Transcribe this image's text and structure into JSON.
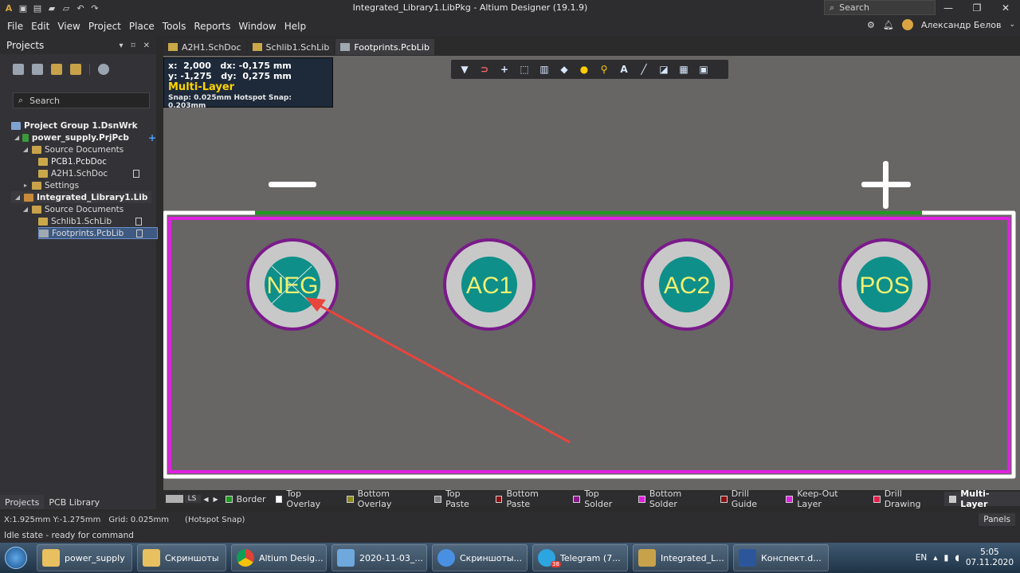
{
  "window": {
    "title": "Integrated_Library1.LibPkg - Altium Designer (19.1.9)",
    "search_placeholder": "Search",
    "controls": [
      "—",
      "❐",
      "✕"
    ]
  },
  "menu": [
    "File",
    "Edit",
    "View",
    "Project",
    "Place",
    "Tools",
    "Reports",
    "Window",
    "Help"
  ],
  "user": {
    "name": "Александр Белов"
  },
  "projects_panel": {
    "title": "Projects",
    "search_placeholder": "Search",
    "tree": [
      {
        "label": "Project Group 1.DsnWrk",
        "bold": true,
        "indent": 0
      },
      {
        "label": "power_supply.PrjPcb",
        "bold": true,
        "indent": 1
      },
      {
        "label": "Source Documents",
        "bold": false,
        "indent": 2
      },
      {
        "label": "PCB1.PcbDoc",
        "bold": false,
        "indent": 3
      },
      {
        "label": "A2H1.SchDoc",
        "bold": false,
        "indent": 3
      },
      {
        "label": "Settings",
        "bold": false,
        "indent": 2
      },
      {
        "label": "Integrated_Library1.Lib",
        "bold": true,
        "indent": 1
      },
      {
        "label": "Source Documents",
        "bold": false,
        "indent": 2
      },
      {
        "label": "Schlib1.SchLib",
        "bold": false,
        "indent": 3
      },
      {
        "label": "Footprints.PcbLib",
        "bold": false,
        "indent": 3
      }
    ],
    "tabs": [
      "Projects",
      "PCB Library"
    ]
  },
  "doc_tabs": [
    "A2H1.SchDoc",
    "Schlib1.SchLib",
    "Footprints.PcbLib"
  ],
  "hud": {
    "line1": "x:  2,000   dx: -0,175 mm",
    "line2": "y: -1,275   dy:  0,275 mm",
    "layer": "Multi-Layer",
    "snap": "Snap: 0.025mm Hotspot Snap: 0.203mm"
  },
  "canvas": {
    "minus_sign": "−",
    "plus_sign": "+",
    "pads": [
      "NEG",
      "AC1",
      "AC2",
      "POS"
    ]
  },
  "layer_tabs": {
    "ls_label": "LS",
    "items": [
      {
        "name": "Border",
        "color": "#1e9a1e"
      },
      {
        "name": "Top Overlay",
        "color": "#ffffff"
      },
      {
        "name": "Bottom Overlay",
        "color": "#8a8a20"
      },
      {
        "name": "Top Paste",
        "color": "#808080"
      },
      {
        "name": "Bottom Paste",
        "color": "#8a1010"
      },
      {
        "name": "Top Solder",
        "color": "#8a1a8a"
      },
      {
        "name": "Bottom Solder",
        "color": "#e020e0"
      },
      {
        "name": "Drill Guide",
        "color": "#8a1010"
      },
      {
        "name": "Keep-Out Layer",
        "color": "#e020e0"
      },
      {
        "name": "Drill Drawing",
        "color": "#e0204a"
      },
      {
        "name": "Multi-Layer",
        "color": "#c8c8c8"
      }
    ]
  },
  "status": {
    "coords": "X:1.925mm Y:-1.275mm",
    "grid": "Grid: 0.025mm",
    "snap": "(Hotspot Snap)",
    "idle": "Idle state - ready for command",
    "panels": "Panels"
  },
  "taskbar": {
    "items": [
      "power_supply",
      "Скриншоты",
      "Altium Desig...",
      "2020-11-03_...",
      "Скриншоты...",
      "Telegram (7...",
      "Integrated_L...",
      "Конспект.d..."
    ],
    "telegram_badge": "38",
    "lang": "EN",
    "time": "5:05",
    "date": "07.11.2020"
  },
  "colors": {
    "canvas": "#686565",
    "outline_white": "#ffffff",
    "keepout": "#e020e0",
    "border_line": "#1e9a1e",
    "pad_ring": "#7a1a8a",
    "pad_copper": "#c8c8c8",
    "pad_hole": "#0e8f8a",
    "pad_text": "#f0f070",
    "arrow": "#e8453c"
  }
}
